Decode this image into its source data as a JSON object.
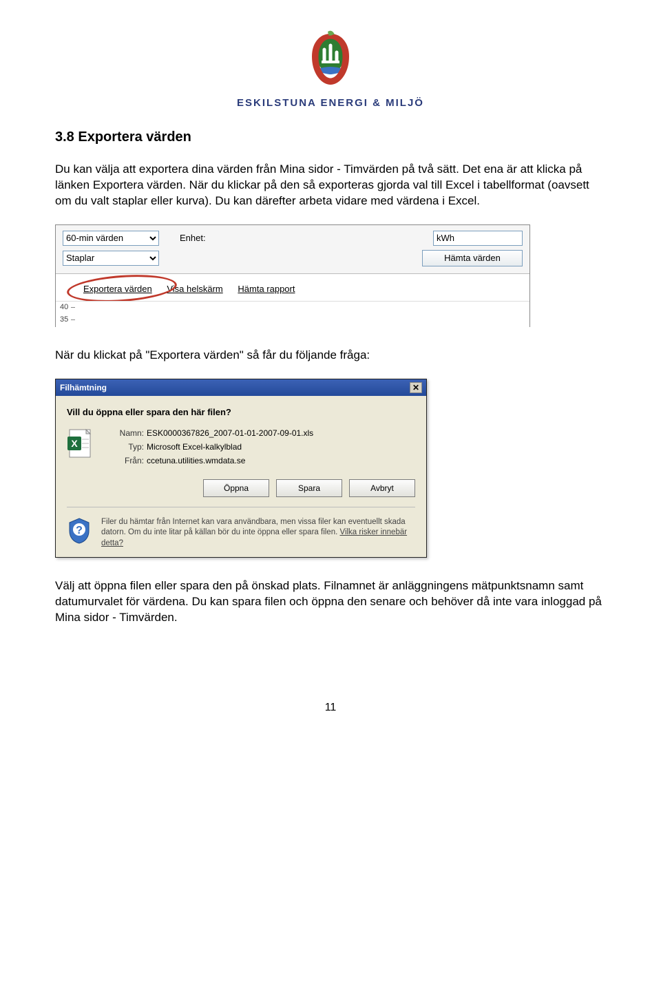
{
  "logo": {
    "company": "ESKILSTUNA ENERGI & MILJÖ"
  },
  "section": {
    "title": "3.8 Exportera värden",
    "para1": "Du kan välja att exportera dina värden från Mina sidor - Timvärden på två sätt. Det ena är att klicka på länken Exportera värden. När du klickar på den så exporteras gjorda val till Excel i tabellformat (oavsett om du valt staplar eller kurva). Du kan därefter arbeta vidare med värdena i Excel.",
    "para2": "När du klickat på \"Exportera värden\" så får du följande fråga:",
    "para3": "Välj att öppna filen eller spara den på önskad plats. Filnamnet är anläggningens mätpunktsnamn samt datumurvalet för värdena. Du kan spara filen och öppna den senare och behöver då inte vara inloggad på Mina sidor - Timvärden."
  },
  "shot1": {
    "select1": "60-min värden",
    "select2": "Staplar",
    "enhet_label": "Enhet:",
    "enhet_value": "kWh",
    "hamta_btn": "Hämta värden",
    "link_export": "Exportera värden",
    "link_fullscreen": "Visa helskärm",
    "link_report": "Hämta rapport",
    "tick40": "40",
    "tick35": "35"
  },
  "dialog": {
    "title": "Filhämtning",
    "question": "Vill du öppna eller spara den här filen?",
    "name_label": "Namn:",
    "name_value": "ESK0000367826_2007-01-01-2007-09-01.xls",
    "type_label": "Typ:",
    "type_value": "Microsoft Excel-kalkylblad",
    "from_label": "Från:",
    "from_value": "ccetuna.utilities.wmdata.se",
    "btn_open": "Öppna",
    "btn_save": "Spara",
    "btn_cancel": "Avbryt",
    "warning_text": "Filer du hämtar från Internet kan vara användbara, men vissa filer kan eventuellt skada datorn. Om du inte litar på källan bör du inte öppna eller spara filen. ",
    "warning_link": "Vilka risker innebär detta?"
  },
  "page_number": "11"
}
